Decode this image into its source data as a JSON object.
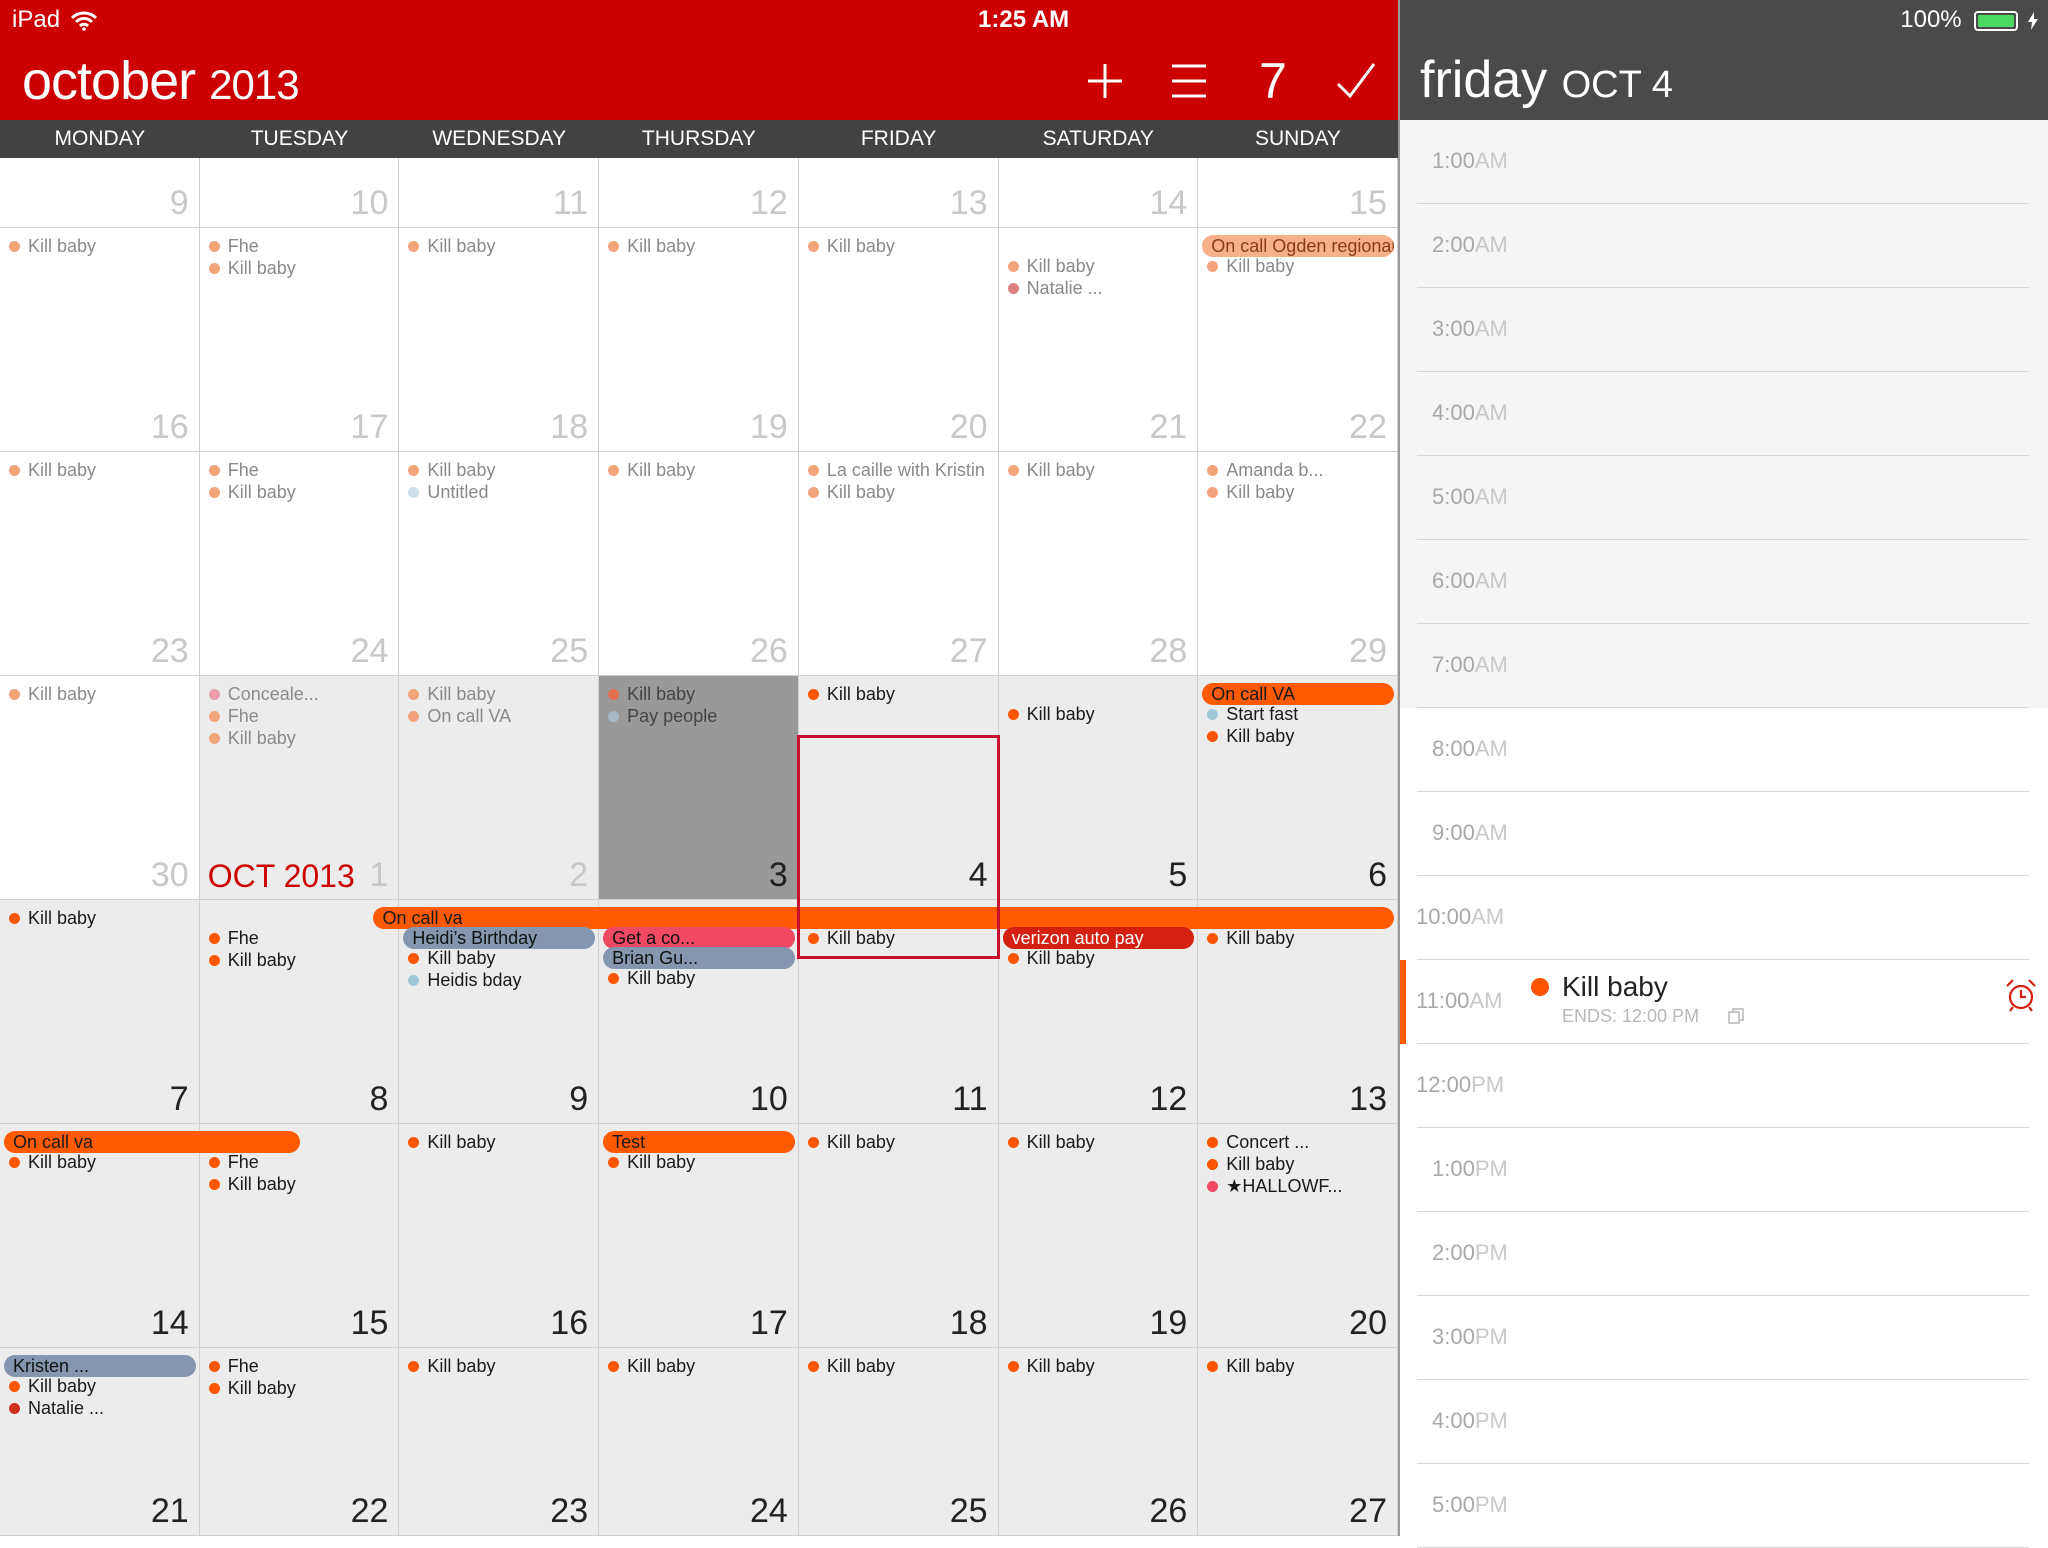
{
  "status": {
    "device": "iPad",
    "time": "1:25 AM",
    "battery": "100%"
  },
  "header": {
    "month": "october",
    "year": "2013",
    "week_button": "7"
  },
  "weekdays": [
    "MONDAY",
    "TUESDAY",
    "WEDNESDAY",
    "THURSDAY",
    "FRIDAY",
    "SATURDAY",
    "SUNDAY"
  ],
  "colors": {
    "header_red": "#cc0000",
    "dark_header": "#4a4a4a",
    "weekday_bar": "#424242",
    "orange": "#ff5a00",
    "blue_gray": "#8496b0",
    "pink": "#f04a62",
    "today_gray": "#999999"
  },
  "calendar": {
    "month_label": "OCT 2013",
    "weeks": [
      [
        {
          "day": "9",
          "state": "past",
          "events": []
        },
        {
          "day": "10",
          "state": "past",
          "events": []
        },
        {
          "day": "11",
          "state": "past",
          "events": []
        },
        {
          "day": "12",
          "state": "past",
          "events": []
        },
        {
          "day": "13",
          "state": "past",
          "events": []
        },
        {
          "day": "14",
          "state": "past",
          "events": []
        },
        {
          "day": "15",
          "state": "past",
          "events": []
        }
      ],
      [
        {
          "day": "16",
          "state": "past",
          "events": [
            {
              "t": "Kill baby",
              "c": "#f2a47c"
            }
          ]
        },
        {
          "day": "17",
          "state": "past",
          "events": [
            {
              "t": "Fhe",
              "c": "#f2a47c"
            },
            {
              "t": "Kill baby",
              "c": "#f2a47c"
            }
          ]
        },
        {
          "day": "18",
          "state": "past",
          "events": [
            {
              "t": "Kill baby",
              "c": "#f2a47c"
            }
          ]
        },
        {
          "day": "19",
          "state": "past",
          "events": [
            {
              "t": "Kill baby",
              "c": "#f2a47c"
            }
          ]
        },
        {
          "day": "20",
          "state": "past",
          "events": [
            {
              "t": "Kill baby",
              "c": "#f2a47c"
            }
          ]
        },
        {
          "day": "21",
          "state": "past",
          "offset": 1,
          "events": [
            {
              "t": "Kill baby",
              "c": "#f2a47c"
            },
            {
              "t": "Natalie ...",
              "c": "#e08080"
            }
          ]
        },
        {
          "day": "22",
          "state": "past",
          "offset": 1,
          "events": [
            {
              "t": "Kill baby",
              "c": "#f2a47c"
            }
          ]
        }
      ],
      [
        {
          "day": "23",
          "state": "past",
          "events": [
            {
              "t": "Kill baby",
              "c": "#f2a47c"
            }
          ]
        },
        {
          "day": "24",
          "state": "past",
          "events": [
            {
              "t": "Fhe",
              "c": "#f2a47c"
            },
            {
              "t": "Kill baby",
              "c": "#f2a47c"
            }
          ]
        },
        {
          "day": "25",
          "state": "past",
          "events": [
            {
              "t": "Kill baby",
              "c": "#f2a47c"
            },
            {
              "t": "Untitled",
              "c": "#cfe0ea"
            }
          ]
        },
        {
          "day": "26",
          "state": "past",
          "events": [
            {
              "t": "Kill baby",
              "c": "#f2a47c"
            }
          ]
        },
        {
          "day": "27",
          "state": "past",
          "events": [
            {
              "t": "La caille with Kristin",
              "c": "#f2a47c"
            },
            {
              "t": "Kill baby",
              "c": "#f2a47c"
            }
          ]
        },
        {
          "day": "28",
          "state": "past",
          "events": [
            {
              "t": "Kill baby",
              "c": "#f2a47c"
            }
          ]
        },
        {
          "day": "29",
          "state": "past",
          "events": [
            {
              "t": "Amanda b...",
              "c": "#f2a47c"
            },
            {
              "t": "Kill baby",
              "c": "#f2a47c"
            }
          ]
        }
      ],
      [
        {
          "day": "30",
          "state": "past",
          "events": [
            {
              "t": "Kill baby",
              "c": "#f2a47c"
            }
          ]
        },
        {
          "day": "1",
          "state": "past-gray",
          "events": [
            {
              "t": "Conceale...",
              "c": "#eba0b0"
            },
            {
              "t": "Fhe",
              "c": "#f2a47c"
            },
            {
              "t": "Kill baby",
              "c": "#f2a47c"
            }
          ]
        },
        {
          "day": "2",
          "state": "past-gray",
          "events": [
            {
              "t": "Kill baby",
              "c": "#f2a47c"
            },
            {
              "t": "On call VA",
              "c": "#f2a47c"
            }
          ]
        },
        {
          "day": "3",
          "state": "today",
          "events": [
            {
              "t": "Kill baby",
              "c": "#e07050"
            },
            {
              "t": "Pay people",
              "c": "#a8b8c4"
            }
          ]
        },
        {
          "day": "4",
          "state": "cur",
          "events": [
            {
              "t": "Kill baby",
              "c": "#ff5500"
            }
          ]
        },
        {
          "day": "5",
          "state": "cur",
          "offset": 1,
          "events": [
            {
              "t": "Kill baby",
              "c": "#ff5500"
            }
          ]
        },
        {
          "day": "6",
          "state": "cur",
          "offset": 1,
          "events": [
            {
              "t": "Start fast",
              "c": "#9ec7d8"
            },
            {
              "t": "Kill baby",
              "c": "#ff5500"
            }
          ]
        }
      ],
      [
        {
          "day": "7",
          "state": "cur",
          "events": [
            {
              "t": "Kill baby",
              "c": "#ff5500"
            }
          ]
        },
        {
          "day": "8",
          "state": "cur",
          "offset": 1,
          "events": [
            {
              "t": "Fhe",
              "c": "#ff5500"
            },
            {
              "t": "Kill baby",
              "c": "#ff5500"
            }
          ]
        },
        {
          "day": "9",
          "state": "cur",
          "offset": 2,
          "events": [
            {
              "t": "Kill baby",
              "c": "#ff5500"
            },
            {
              "t": "Heidis bday",
              "c": "#9ec7d8"
            }
          ]
        },
        {
          "day": "10",
          "state": "cur",
          "offset": 3,
          "events": [
            {
              "t": "Kill baby",
              "c": "#ff5500"
            }
          ]
        },
        {
          "day": "11",
          "state": "cur",
          "offset": 1,
          "events": [
            {
              "t": "Kill baby",
              "c": "#ff5500"
            }
          ]
        },
        {
          "day": "12",
          "state": "cur",
          "offset": 2,
          "events": [
            {
              "t": "Kill baby",
              "c": "#ff5500"
            }
          ]
        },
        {
          "day": "13",
          "state": "cur",
          "offset": 1,
          "events": [
            {
              "t": "Kill baby",
              "c": "#ff5500"
            }
          ]
        }
      ],
      [
        {
          "day": "14",
          "state": "cur",
          "offset": 1,
          "events": [
            {
              "t": "Kill baby",
              "c": "#ff5500"
            }
          ]
        },
        {
          "day": "15",
          "state": "cur",
          "offset": 1,
          "events": [
            {
              "t": "Fhe",
              "c": "#ff5500"
            },
            {
              "t": "Kill baby",
              "c": "#ff5500"
            }
          ]
        },
        {
          "day": "16",
          "state": "cur",
          "events": [
            {
              "t": "Kill baby",
              "c": "#ff5500"
            }
          ]
        },
        {
          "day": "17",
          "state": "cur",
          "offset": 1,
          "events": [
            {
              "t": "Kill baby",
              "c": "#ff5500"
            }
          ]
        },
        {
          "day": "18",
          "state": "cur",
          "events": [
            {
              "t": "Kill baby",
              "c": "#ff5500"
            }
          ]
        },
        {
          "day": "19",
          "state": "cur",
          "events": [
            {
              "t": "Kill baby",
              "c": "#ff5500"
            }
          ]
        },
        {
          "day": "20",
          "state": "cur",
          "events": [
            {
              "t": "Concert ...",
              "c": "#ff5500"
            },
            {
              "t": "Kill baby",
              "c": "#ff5500"
            },
            {
              "t": "★HALLOWF...",
              "c": "#f04a62"
            }
          ]
        }
      ],
      [
        {
          "day": "21",
          "state": "cur",
          "offset": 1,
          "events": [
            {
              "t": "Kill baby",
              "c": "#ff5500"
            },
            {
              "t": "Natalie ...",
              "c": "#d03020"
            }
          ]
        },
        {
          "day": "22",
          "state": "cur",
          "events": [
            {
              "t": "Fhe",
              "c": "#ff5500"
            },
            {
              "t": "Kill baby",
              "c": "#ff5500"
            }
          ]
        },
        {
          "day": "23",
          "state": "cur",
          "events": [
            {
              "t": "Kill baby",
              "c": "#ff5500"
            }
          ]
        },
        {
          "day": "24",
          "state": "cur",
          "events": [
            {
              "t": "Kill baby",
              "c": "#ff5500"
            }
          ]
        },
        {
          "day": "25",
          "state": "cur",
          "events": [
            {
              "t": "Kill baby",
              "c": "#ff5500"
            }
          ]
        },
        {
          "day": "26",
          "state": "cur",
          "events": [
            {
              "t": "Kill baby",
              "c": "#ff5500"
            }
          ]
        },
        {
          "day": "27",
          "state": "cur",
          "events": [
            {
              "t": "Kill baby",
              "c": "#ff5500"
            }
          ]
        }
      ]
    ],
    "pills": [
      {
        "name": "pill-on-call-ogden",
        "t": "On call Ogden regional",
        "bg": "#f6b08a",
        "fg": "#8a3c14",
        "week": 1,
        "col": 6,
        "span": 1,
        "row": 0
      },
      {
        "name": "pill-on-call-va-6",
        "t": "On call VA",
        "bg": "#ff5a00",
        "fg": "#1a1a1a",
        "week": 3,
        "col": 6,
        "span": 1,
        "row": 0
      },
      {
        "name": "pill-on-call-va-week",
        "t": "On call va",
        "bg": "#ff5a00",
        "fg": "#1a1a1a",
        "week": 4,
        "col": 1.85,
        "span": 5.15,
        "row": 0
      },
      {
        "name": "pill-heidis-birthday",
        "t": "Heidi’s Birthday",
        "bg": "#8496b0",
        "fg": "#111",
        "week": 4,
        "col": 2,
        "span": 1,
        "row": 1
      },
      {
        "name": "pill-get-a-co",
        "t": "Get a co...",
        "bg": "#f04a62",
        "fg": "#111",
        "week": 4,
        "col": 3,
        "span": 1,
        "row": 1
      },
      {
        "name": "pill-brian-gu",
        "t": "Brian Gu...",
        "bg": "#8496b0",
        "fg": "#111",
        "week": 4,
        "col": 3,
        "span": 1,
        "row": 2
      },
      {
        "name": "pill-verizon",
        "t": "verizon auto pay",
        "bg": "#d42010",
        "fg": "#fff",
        "week": 4,
        "col": 5,
        "span": 1,
        "row": 1
      },
      {
        "name": "pill-on-call-va-14",
        "t": "On call va",
        "bg": "#ff5a00",
        "fg": "#1a1a1a",
        "week": 5,
        "col": 0,
        "span": 1.52,
        "row": 0
      },
      {
        "name": "pill-test",
        "t": "Test",
        "bg": "#ff5a00",
        "fg": "#1a1a1a",
        "week": 5,
        "col": 3,
        "span": 1,
        "row": 0
      },
      {
        "name": "pill-kristen",
        "t": "Kristen ...",
        "bg": "#8496b0",
        "fg": "#111",
        "week": 6,
        "col": 0,
        "span": 1,
        "row": 0
      }
    ]
  },
  "day_view": {
    "weekday": "friday",
    "date": "OCT 4",
    "hours": [
      {
        "h": "1:00",
        "m": "AM"
      },
      {
        "h": "2:00",
        "m": "AM"
      },
      {
        "h": "3:00",
        "m": "AM"
      },
      {
        "h": "4:00",
        "m": "AM"
      },
      {
        "h": "5:00",
        "m": "AM"
      },
      {
        "h": "6:00",
        "m": "AM"
      },
      {
        "h": "7:00",
        "m": "AM"
      },
      {
        "h": "8:00",
        "m": "AM"
      },
      {
        "h": "9:00",
        "m": "AM"
      },
      {
        "h": "10:00",
        "m": "AM"
      },
      {
        "h": "11:00",
        "m": "AM"
      },
      {
        "h": "12:00",
        "m": "PM"
      },
      {
        "h": "1:00",
        "m": "PM"
      },
      {
        "h": "2:00",
        "m": "PM"
      },
      {
        "h": "3:00",
        "m": "PM"
      },
      {
        "h": "4:00",
        "m": "PM"
      },
      {
        "h": "5:00",
        "m": "PM"
      }
    ],
    "event": {
      "title": "Kill baby",
      "ends": "ENDS: 12:00 PM",
      "color": "#ff5500"
    }
  }
}
